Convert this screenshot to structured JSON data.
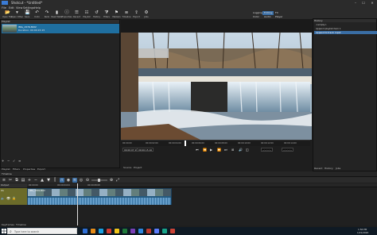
{
  "window": {
    "title": "Shotcut - *Untitled*",
    "min": "–",
    "max": "☐",
    "close": "✕"
  },
  "menu": [
    "File",
    "Edit",
    "View",
    "Settings",
    "Help"
  ],
  "toolbar": [
    {
      "icon": "open-icon",
      "glyph": "📂",
      "label": "Open File"
    },
    {
      "icon": "open-other-icon",
      "glyph": "▾",
      "label": "Open Other"
    },
    {
      "icon": "save-icon",
      "glyph": "💾",
      "label": "Save"
    },
    {
      "icon": "undo-icon",
      "glyph": "↶",
      "label": "Undo"
    },
    {
      "icon": "redo-icon",
      "glyph": "↷",
      "label": "Redo"
    },
    {
      "icon": "peak-meter-icon",
      "glyph": "▮",
      "label": "Peak Meter"
    },
    {
      "icon": "properties-icon",
      "glyph": "ⓘ",
      "label": "Properties"
    },
    {
      "icon": "recent-icon",
      "glyph": "☰",
      "label": "Recent"
    },
    {
      "icon": "playlist-icon",
      "glyph": "☷",
      "label": "Playlist"
    },
    {
      "icon": "history-icon",
      "glyph": "↺",
      "label": "History"
    },
    {
      "icon": "filters-icon",
      "glyph": "⧩",
      "label": "Filters"
    },
    {
      "icon": "markers-icon",
      "glyph": "⚑",
      "label": "Markers"
    },
    {
      "icon": "timeline-icon",
      "glyph": "≡",
      "label": "Timeline"
    },
    {
      "icon": "export-icon",
      "glyph": "⇪",
      "label": "Export"
    },
    {
      "icon": "jobs-icon",
      "glyph": "⚙",
      "label": "Jobs"
    }
  ],
  "layouts": {
    "top": [
      "Logging",
      "Editing",
      "FX"
    ],
    "bottom": [
      "Color",
      "Audio",
      "Player"
    ],
    "active": "Editing"
  },
  "playlist": {
    "header": "Playlist",
    "item": {
      "name": "IMG_1579.MOV",
      "duration": "Duration: 00:00:15:15"
    },
    "tabs": [
      "Playlist",
      "Filters",
      "Properties",
      "Export"
    ],
    "controls": [
      "+",
      "−",
      "✓",
      "≡"
    ]
  },
  "viewer": {
    "ruler": [
      "00:00:00",
      "00:00:02:00",
      "00:00:04:00",
      "00:00:06:00",
      "00:00:08:00",
      "00:00:10:00",
      "00:00:12:00",
      "00:00:14:00"
    ],
    "timecode_current": "00:00:07:19",
    "timecode_total": "00:00:15:16",
    "in_point": "--:--:--:--",
    "out_point": "--:--:--:--",
    "transport": [
      "⏮",
      "⏪",
      "▶",
      "⏩",
      "⏭",
      "⊞",
      "🔊",
      "◫"
    ],
    "source_tabs": [
      "Source",
      "Project"
    ]
  },
  "history": {
    "header": "History",
    "rows": [
      {
        "label": "<empty>",
        "selected": false
      },
      {
        "label": "Append playlist item 1",
        "selected": false
      },
      {
        "label": "Append to track: Input",
        "selected": true
      }
    ],
    "tabs": [
      "Recent",
      "History",
      "Jobs"
    ]
  },
  "timeline": {
    "header": "Timeline",
    "track_label": "Output",
    "track_name": "V1",
    "clip_name": "IMG_1579.MOV",
    "ruler": [
      "00:00:00",
      "00:00:04:04",
      "00:00:08:08"
    ],
    "bottom_tabs": [
      "Keyframes",
      "Timeline"
    ]
  },
  "taskbar": {
    "search_placeholder": "Type here to search",
    "apps": [
      "#2f6fd6",
      "#e58a17",
      "#1a9fe0",
      "#d43a2f",
      "#f0c419",
      "#1f7a3a",
      "#7a3fb5",
      "#2e86de",
      "#c0392b",
      "#5c7cfa",
      "#17a589",
      "#cb4335"
    ],
    "tray_time": "1:56 PM",
    "tray_date": "1/21/2020"
  }
}
